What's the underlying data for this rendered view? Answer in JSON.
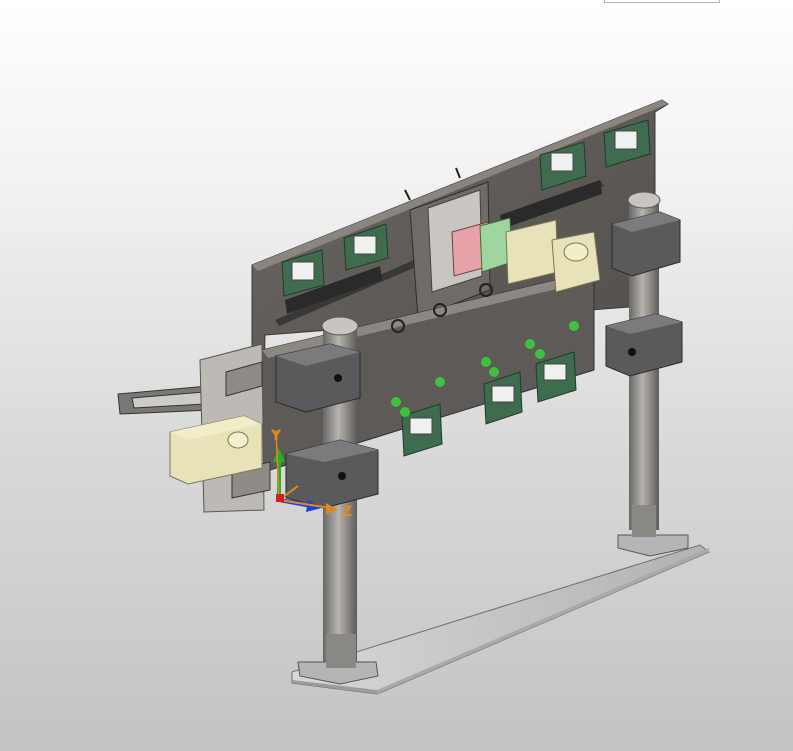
{
  "viewport": {
    "background_top": "#ffffff",
    "background_bottom": "#c3c3c3"
  },
  "triad": {
    "x_label": "",
    "y_label": "Y",
    "z_label": "Z",
    "x_color": "#1f3fd8",
    "y_color": "#22b322",
    "z_color": "#e08a1e"
  },
  "model": {
    "plate_color": "#5f5b57",
    "block_color": "#5a5a5c",
    "rod_color": "#8d8b88",
    "base_color": "#c9c9cb",
    "motor_color": "#e7e2b8",
    "coupler_pink": "#e7a3a9",
    "coupler_green": "#9fd6a0",
    "pcb_color": "#3f6b4e",
    "fitting_color": "#3fc13f"
  }
}
